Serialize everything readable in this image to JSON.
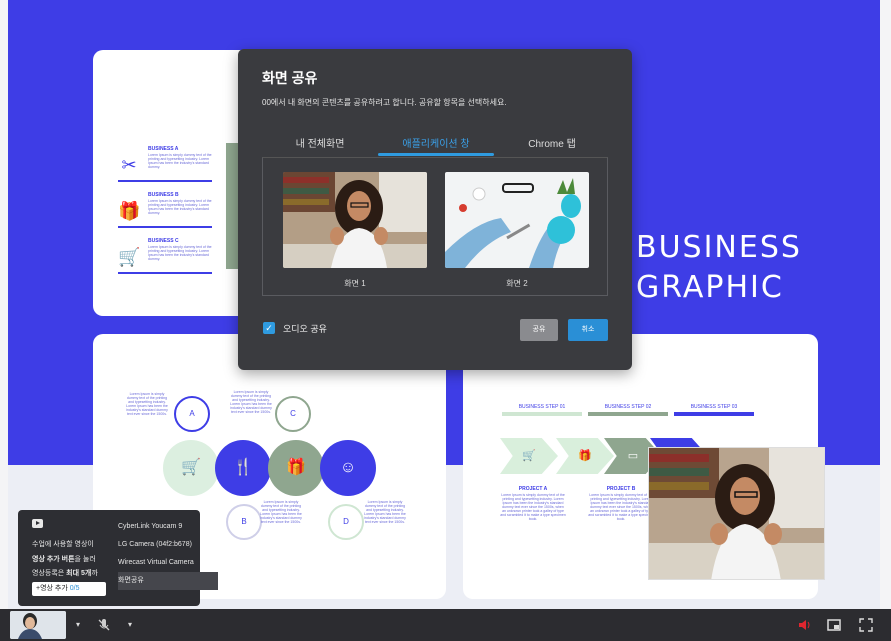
{
  "slide": {
    "title_line1": "BUSINESS",
    "title_line2": "GRAPHIC",
    "biz_items": [
      {
        "title": "BUSINESS A",
        "desc": "Lorem Ipsum is simply dummy text of the printing and typesetting industry. Lorem Ipsum has been the industry's standard dummy.",
        "icon": "scissors-icon",
        "glyph": "✂"
      },
      {
        "title": "BUSINESS B",
        "desc": "Lorem Ipsum is simply dummy text of the printing and typesetting industry. Lorem Ipsum has been the industry's standard dummy.",
        "icon": "gift-icon",
        "glyph": "🎁"
      },
      {
        "title": "BUSINESS C",
        "desc": "Lorem Ipsum is simply dummy text of the printing and typesetting industry. Lorem Ipsum has been the industry's standard dummy.",
        "icon": "cart-icon",
        "glyph": "🛒"
      }
    ],
    "steps": [
      "BUSINESS STEP 01",
      "BUSINESS STEP 02",
      "BUSINESS STEP 03"
    ],
    "projects": [
      {
        "title": "PROJECT A",
        "desc": "Lorem Ipsum is simply dummy text of the printing and typesetting industry. Lorem Ipsum has been the industry's standard dummy text ever since the 1500s, when an unknown printer took a galley of type and scrambled it to make a type specimen book."
      },
      {
        "title": "PROJECT B",
        "desc": "Lorem Ipsum is simply dummy text of the printing and typesetting industry. Lorem Ipsum has been the industry's standard dummy text ever since the 1500s, when an unknown printer took a galley of type and scrambled it to make a type specimen book."
      }
    ],
    "circle_letters": [
      "A",
      "B",
      "C",
      "D"
    ],
    "circle_text": "Lorem Ipsum is simply dummy text of the printing and typesetting industry. Lorem Ipsum has been the industry's standard dummy text ever since the 1500s."
  },
  "dialog": {
    "title": "화면 공유",
    "subtitle": "00에서 내 화면의 콘텐츠를 공유하려고 합니다. 공유할 항목을 선택하세요.",
    "tabs": [
      "내 전체화면",
      "애플리케이션 창",
      "Chrome 탭"
    ],
    "active_tab": 1,
    "windows": [
      "화면 1",
      "화면 2"
    ],
    "audio_label": "오디오 공유",
    "audio_checked": true,
    "share_label": "공유",
    "cancel_label": "취소"
  },
  "popup": {
    "line1": "수업에 사용할 영상이",
    "line2_bold": "영상 추가 버튼",
    "line2_rest": "을 눌러",
    "line3_pre": "영상등록은 ",
    "line3_bold": "최대 5개",
    "line3_post": "까",
    "add_label": "+영상 추가",
    "count": "0/5",
    "cameras": [
      "CyberLink Youcam 9",
      "LG Camera (04f2:b678)",
      "Wirecast Virtual Camera",
      "화면공유"
    ]
  },
  "colors": {
    "accent": "#3e3de6",
    "dialog_bg": "#3a3b3f",
    "tab_active": "#2f9be0",
    "bottom_bar": "#2c2c30",
    "mute_red": "#e0262f"
  }
}
